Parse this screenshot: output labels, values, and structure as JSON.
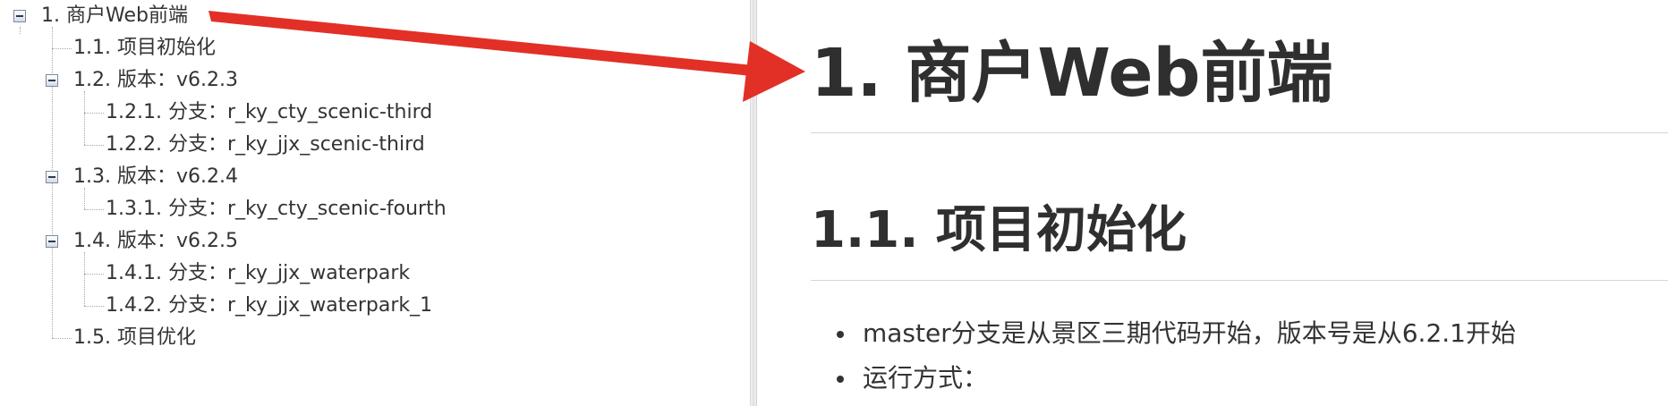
{
  "toc": {
    "items": [
      {
        "label": "1. 商户Web前端"
      },
      {
        "label": "1.1. 项目初始化"
      },
      {
        "label": "1.2. 版本：v6.2.3"
      },
      {
        "label": "1.2.1. 分支：r_ky_cty_scenic-third"
      },
      {
        "label": "1.2.2. 分支：r_ky_jjx_scenic-third"
      },
      {
        "label": "1.3. 版本：v6.2.4"
      },
      {
        "label": "1.3.1. 分支：r_ky_cty_scenic-fourth"
      },
      {
        "label": "1.4. 版本：v6.2.5"
      },
      {
        "label": "1.4.1. 分支：r_ky_jjx_waterpark"
      },
      {
        "label": "1.4.2. 分支：r_ky_jjx_waterpark_1"
      },
      {
        "label": "1.5. 项目优化"
      }
    ]
  },
  "content": {
    "h1": "1. 商户Web前端",
    "h2": "1.1. 项目初始化",
    "bullets": [
      "master分支是从景区三期代码开始，版本号是从6.2.1开始",
      "运行方式："
    ]
  },
  "colors": {
    "arrow": "#e23027",
    "heading": "#2f2f2f",
    "text": "#333333"
  },
  "icons": {
    "collapse": "minus-box-icon"
  }
}
